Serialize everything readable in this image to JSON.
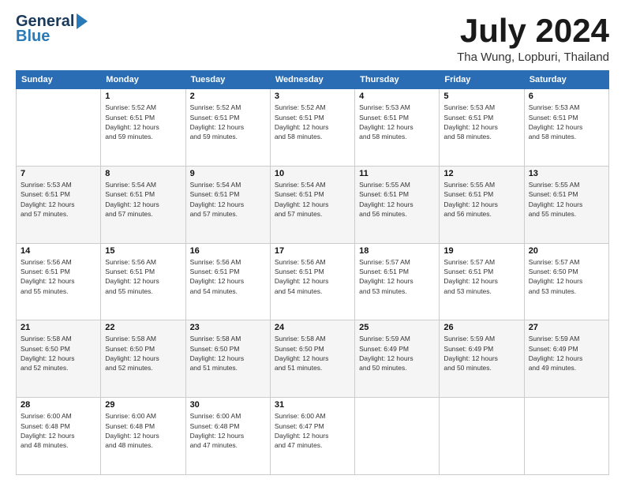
{
  "header": {
    "logo_line1": "General",
    "logo_line2": "Blue",
    "month_title": "July 2024",
    "location": "Tha Wung, Lopburi, Thailand"
  },
  "days_of_week": [
    "Sunday",
    "Monday",
    "Tuesday",
    "Wednesday",
    "Thursday",
    "Friday",
    "Saturday"
  ],
  "weeks": [
    [
      {
        "day": "",
        "info": ""
      },
      {
        "day": "1",
        "info": "Sunrise: 5:52 AM\nSunset: 6:51 PM\nDaylight: 12 hours\nand 59 minutes."
      },
      {
        "day": "2",
        "info": "Sunrise: 5:52 AM\nSunset: 6:51 PM\nDaylight: 12 hours\nand 59 minutes."
      },
      {
        "day": "3",
        "info": "Sunrise: 5:52 AM\nSunset: 6:51 PM\nDaylight: 12 hours\nand 58 minutes."
      },
      {
        "day": "4",
        "info": "Sunrise: 5:53 AM\nSunset: 6:51 PM\nDaylight: 12 hours\nand 58 minutes."
      },
      {
        "day": "5",
        "info": "Sunrise: 5:53 AM\nSunset: 6:51 PM\nDaylight: 12 hours\nand 58 minutes."
      },
      {
        "day": "6",
        "info": "Sunrise: 5:53 AM\nSunset: 6:51 PM\nDaylight: 12 hours\nand 58 minutes."
      }
    ],
    [
      {
        "day": "7",
        "info": "Sunrise: 5:53 AM\nSunset: 6:51 PM\nDaylight: 12 hours\nand 57 minutes."
      },
      {
        "day": "8",
        "info": "Sunrise: 5:54 AM\nSunset: 6:51 PM\nDaylight: 12 hours\nand 57 minutes."
      },
      {
        "day": "9",
        "info": "Sunrise: 5:54 AM\nSunset: 6:51 PM\nDaylight: 12 hours\nand 57 minutes."
      },
      {
        "day": "10",
        "info": "Sunrise: 5:54 AM\nSunset: 6:51 PM\nDaylight: 12 hours\nand 57 minutes."
      },
      {
        "day": "11",
        "info": "Sunrise: 5:55 AM\nSunset: 6:51 PM\nDaylight: 12 hours\nand 56 minutes."
      },
      {
        "day": "12",
        "info": "Sunrise: 5:55 AM\nSunset: 6:51 PM\nDaylight: 12 hours\nand 56 minutes."
      },
      {
        "day": "13",
        "info": "Sunrise: 5:55 AM\nSunset: 6:51 PM\nDaylight: 12 hours\nand 55 minutes."
      }
    ],
    [
      {
        "day": "14",
        "info": "Sunrise: 5:56 AM\nSunset: 6:51 PM\nDaylight: 12 hours\nand 55 minutes."
      },
      {
        "day": "15",
        "info": "Sunrise: 5:56 AM\nSunset: 6:51 PM\nDaylight: 12 hours\nand 55 minutes."
      },
      {
        "day": "16",
        "info": "Sunrise: 5:56 AM\nSunset: 6:51 PM\nDaylight: 12 hours\nand 54 minutes."
      },
      {
        "day": "17",
        "info": "Sunrise: 5:56 AM\nSunset: 6:51 PM\nDaylight: 12 hours\nand 54 minutes."
      },
      {
        "day": "18",
        "info": "Sunrise: 5:57 AM\nSunset: 6:51 PM\nDaylight: 12 hours\nand 53 minutes."
      },
      {
        "day": "19",
        "info": "Sunrise: 5:57 AM\nSunset: 6:51 PM\nDaylight: 12 hours\nand 53 minutes."
      },
      {
        "day": "20",
        "info": "Sunrise: 5:57 AM\nSunset: 6:50 PM\nDaylight: 12 hours\nand 53 minutes."
      }
    ],
    [
      {
        "day": "21",
        "info": "Sunrise: 5:58 AM\nSunset: 6:50 PM\nDaylight: 12 hours\nand 52 minutes."
      },
      {
        "day": "22",
        "info": "Sunrise: 5:58 AM\nSunset: 6:50 PM\nDaylight: 12 hours\nand 52 minutes."
      },
      {
        "day": "23",
        "info": "Sunrise: 5:58 AM\nSunset: 6:50 PM\nDaylight: 12 hours\nand 51 minutes."
      },
      {
        "day": "24",
        "info": "Sunrise: 5:58 AM\nSunset: 6:50 PM\nDaylight: 12 hours\nand 51 minutes."
      },
      {
        "day": "25",
        "info": "Sunrise: 5:59 AM\nSunset: 6:49 PM\nDaylight: 12 hours\nand 50 minutes."
      },
      {
        "day": "26",
        "info": "Sunrise: 5:59 AM\nSunset: 6:49 PM\nDaylight: 12 hours\nand 50 minutes."
      },
      {
        "day": "27",
        "info": "Sunrise: 5:59 AM\nSunset: 6:49 PM\nDaylight: 12 hours\nand 49 minutes."
      }
    ],
    [
      {
        "day": "28",
        "info": "Sunrise: 6:00 AM\nSunset: 6:48 PM\nDaylight: 12 hours\nand 48 minutes."
      },
      {
        "day": "29",
        "info": "Sunrise: 6:00 AM\nSunset: 6:48 PM\nDaylight: 12 hours\nand 48 minutes."
      },
      {
        "day": "30",
        "info": "Sunrise: 6:00 AM\nSunset: 6:48 PM\nDaylight: 12 hours\nand 47 minutes."
      },
      {
        "day": "31",
        "info": "Sunrise: 6:00 AM\nSunset: 6:47 PM\nDaylight: 12 hours\nand 47 minutes."
      },
      {
        "day": "",
        "info": ""
      },
      {
        "day": "",
        "info": ""
      },
      {
        "day": "",
        "info": ""
      }
    ]
  ]
}
